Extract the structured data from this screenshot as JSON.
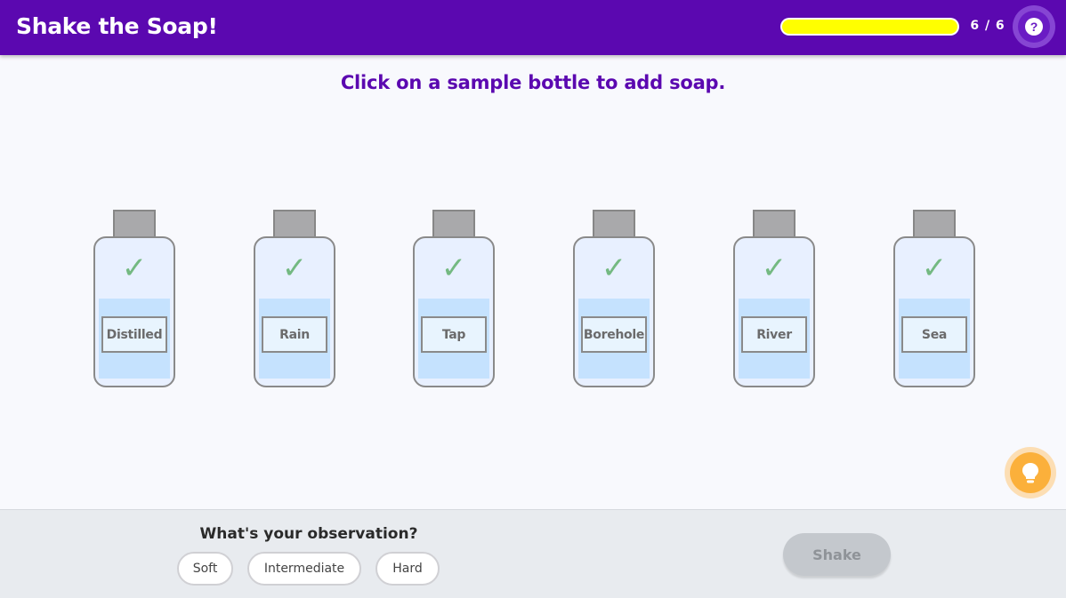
{
  "header": {
    "title": "Shake the Soap!",
    "progress": {
      "current": 6,
      "total": 6,
      "fraction": 1.0,
      "label": "6 / 6"
    },
    "help_icon": "question-mark-icon",
    "help_label": "?"
  },
  "instruction": "Click on a sample bottle to add soap.",
  "bottles": [
    {
      "label": "Distilled",
      "check": "✓"
    },
    {
      "label": "Rain",
      "check": "✓"
    },
    {
      "label": "Tap",
      "check": "✓"
    },
    {
      "label": "Borehole",
      "check": "✓"
    },
    {
      "label": "River",
      "check": "✓"
    },
    {
      "label": "Sea",
      "check": "✓"
    }
  ],
  "hint": {
    "icon": "lightbulb-icon"
  },
  "observation": {
    "question": "What's your observation?",
    "options": [
      "Soft",
      "Intermediate",
      "Hard"
    ]
  },
  "shake_label": "Shake",
  "colors": {
    "header": "#5b08b0",
    "progress": "#ffff00",
    "check": "#74b982",
    "water": "#c5e2fe",
    "hint": "#fbb03b"
  }
}
